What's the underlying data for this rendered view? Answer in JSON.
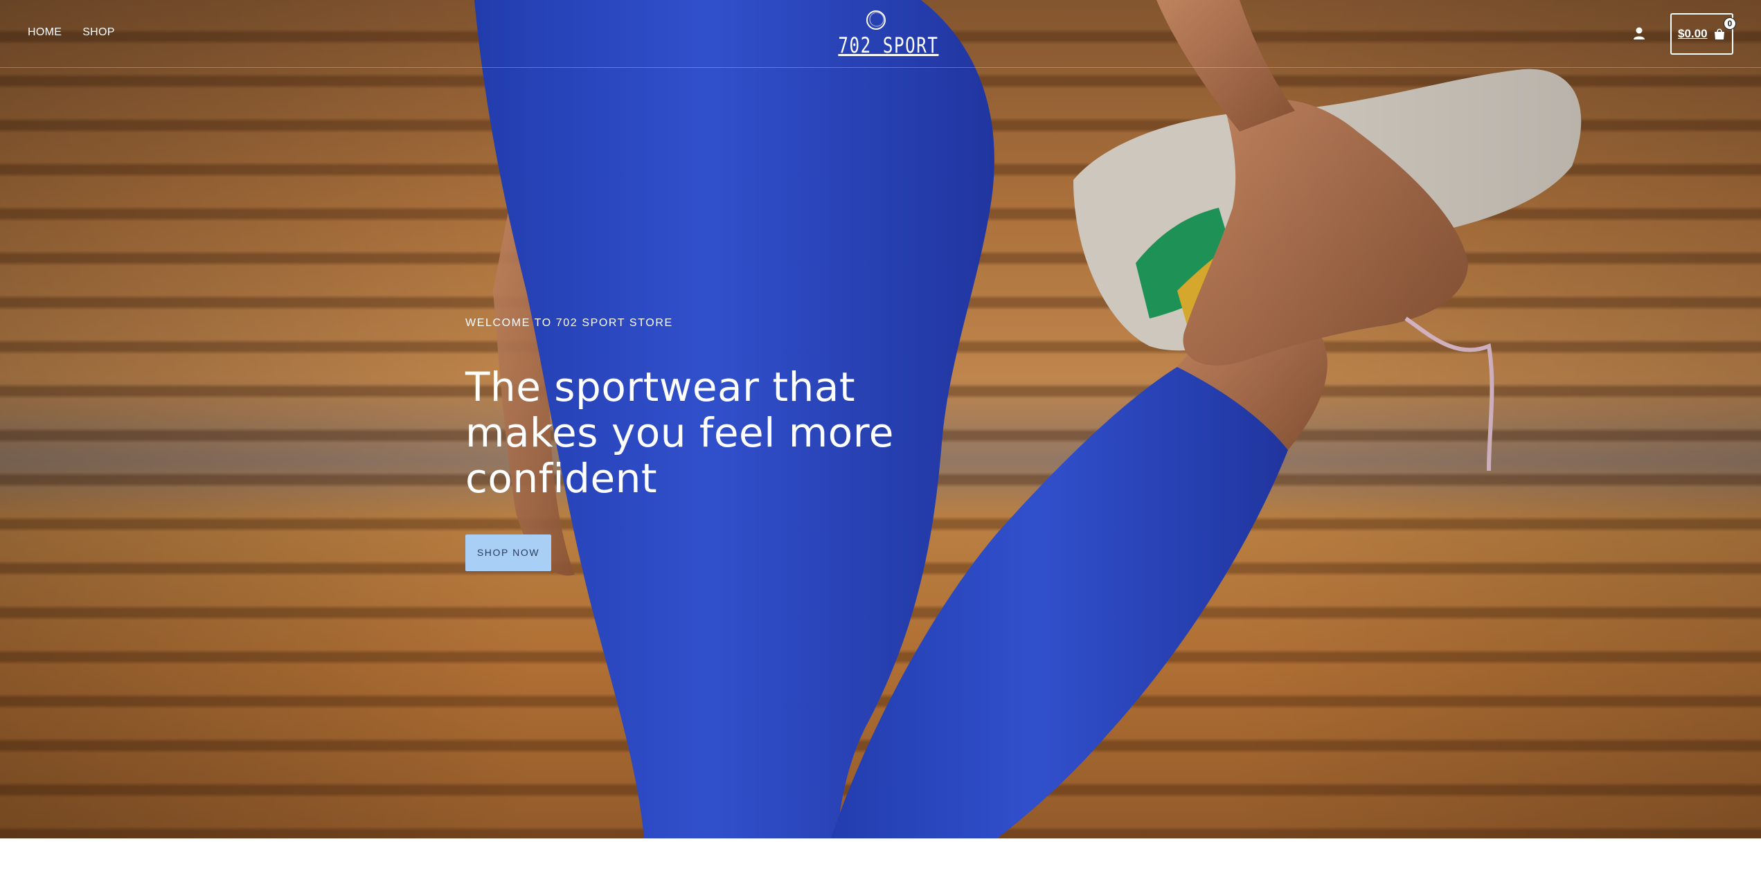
{
  "header": {
    "nav": [
      {
        "label": "HOME"
      },
      {
        "label": "SHOP"
      }
    ],
    "logo_text": "702 SPORT",
    "account_icon": "user-icon",
    "cart": {
      "total": "$0.00",
      "count": "0",
      "icon": "shopping-bag-icon"
    }
  },
  "hero": {
    "eyebrow": "WELCOME TO 702 SPORT STORE",
    "headline_lines": [
      "The sportwear that",
      "makes you feel more",
      "confident"
    ],
    "cta_label": "SHOP NOW"
  },
  "colors": {
    "cta_background": "#a9cff7",
    "cta_text": "#2a3d5a",
    "leggings": "#2f4fcf",
    "background_wood": "#c48645"
  }
}
